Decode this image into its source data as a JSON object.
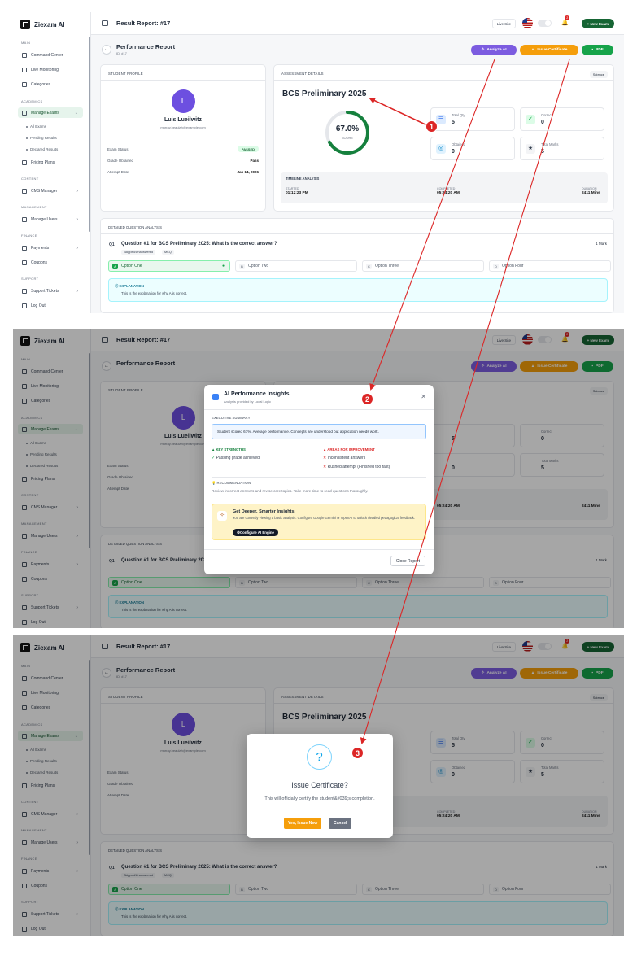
{
  "app": {
    "logo": "Ziexam AI",
    "header_title": "Result Report: #17",
    "live_site": "Live Site",
    "notifications": "2",
    "new_exam": "+ New Exam"
  },
  "sidebar": {
    "sections": {
      "main": "MAIN",
      "academics": "ACADEMICS",
      "content": "CONTENT",
      "management": "MANAGEMENT",
      "finance": "FINANCE",
      "support": "SUPPORT"
    },
    "items": {
      "command_center": "Command Center",
      "live_monitoring": "Live Monitoring",
      "categories": "Categories",
      "manage_exams": "Manage Exams",
      "all_exams": "All Exams",
      "pending_results": "Pending Results",
      "declared_results": "Declared Results",
      "pricing_plans": "Pricing Plans",
      "cms_manager": "CMS Manager",
      "manage_users": "Manage Users",
      "payments": "Payments",
      "coupons": "Coupons",
      "support_tickets": "Support Tickets",
      "log_out": "Log Out"
    }
  },
  "report": {
    "title": "Performance Report",
    "id": "ID: #17",
    "analyze_ai": "Analyze AI",
    "issue_certificate": "Issue Certificate",
    "pdf": "PDF"
  },
  "profile": {
    "header": "STUDENT PROFILE",
    "initial": "L",
    "name": "Luis Lueilwitz",
    "email": "murray.beaulah@example.com",
    "exam_status_label": "Exam Status",
    "exam_status": "PASSED",
    "grade_label": "Grade Obtained",
    "grade": "Pass",
    "attempt_label": "Attempt Date",
    "attempt_date": "Jan 14, 2026"
  },
  "assessment": {
    "header": "ASSESSMENT DETAILS",
    "subject": "Science",
    "exam_title": "BCS Preliminary 2025",
    "score": "67.0%",
    "score_label": "SCORE",
    "score_value": 0.67,
    "total_qty_label": "Total Qty",
    "total_qty": "5",
    "correct_label": "Correct",
    "correct": "0",
    "obtained_label": "Obtained",
    "obtained": "0",
    "total_marks_label": "Total Marks",
    "total_marks": "5",
    "timeline_header": "TIMELINE ANALYSIS",
    "started_label": "STARTED",
    "started": "01:12:23 PM",
    "completed_label": "COMPLETED",
    "completed": "05:24:20 AM",
    "duration_label": "DURATION",
    "duration": "2411 Mins"
  },
  "questions": {
    "header": "DETAILED QUESTION ANALYSIS",
    "q_num": "Q1",
    "q_text": "Question #1 for BCS Preliminary 2025: What is the correct answer?",
    "marks": "1 Mark",
    "tag_status": "Skipped/Unanswered",
    "tag_type": "MCQ",
    "options": [
      {
        "key": "A",
        "label": "Option One"
      },
      {
        "key": "B",
        "label": "Option Two"
      },
      {
        "key": "C",
        "label": "Option Three"
      },
      {
        "key": "D",
        "label": "Option Four"
      }
    ],
    "explanation_title": "EXPLANATION",
    "explanation": "This is the explanation for why A is correct."
  },
  "ai_modal": {
    "title": "AI Performance Insights",
    "subtitle": "Analysis provided by Local Logic",
    "exec_header": "EXECUTIVE SUMMARY",
    "exec_summary": "Student scored 67%. Average performance. Concepts are understood but application needs work.",
    "strengths_header": "KEY STRENGTHS",
    "strength_1": "Passing grade achieved",
    "improve_header": "AREAS FOR IMPROVEMENT",
    "improve_1": "Inconsistent answers",
    "improve_2": "Rushed attempt (Finished too fast)",
    "rec_header": "RECOMMENDATION",
    "rec_text": "Review incorrect answers and revise core topics. Take more time to read questions thoroughly.",
    "promo_title": "Get Deeper, Smarter Insights",
    "promo_text": "You are currently viewing a basic analysis. Configure Google Gemini or OpenAI to unlock detailed pedagogical feedback.",
    "promo_button": "Configure AI Engine",
    "close": "Close Report"
  },
  "cert_modal": {
    "icon": "?",
    "title": "Issue Certificate?",
    "text": "This will officially certify the student&#039;s completion.",
    "yes": "Yes, Issue Now",
    "cancel": "Cancel"
  },
  "callouts": [
    "1",
    "2",
    "3"
  ],
  "colors": {
    "brand_green": "#166534",
    "ai_purple": "#7c5ce0",
    "cert_amber": "#f59e0b",
    "callout_red": "#dc2626"
  }
}
